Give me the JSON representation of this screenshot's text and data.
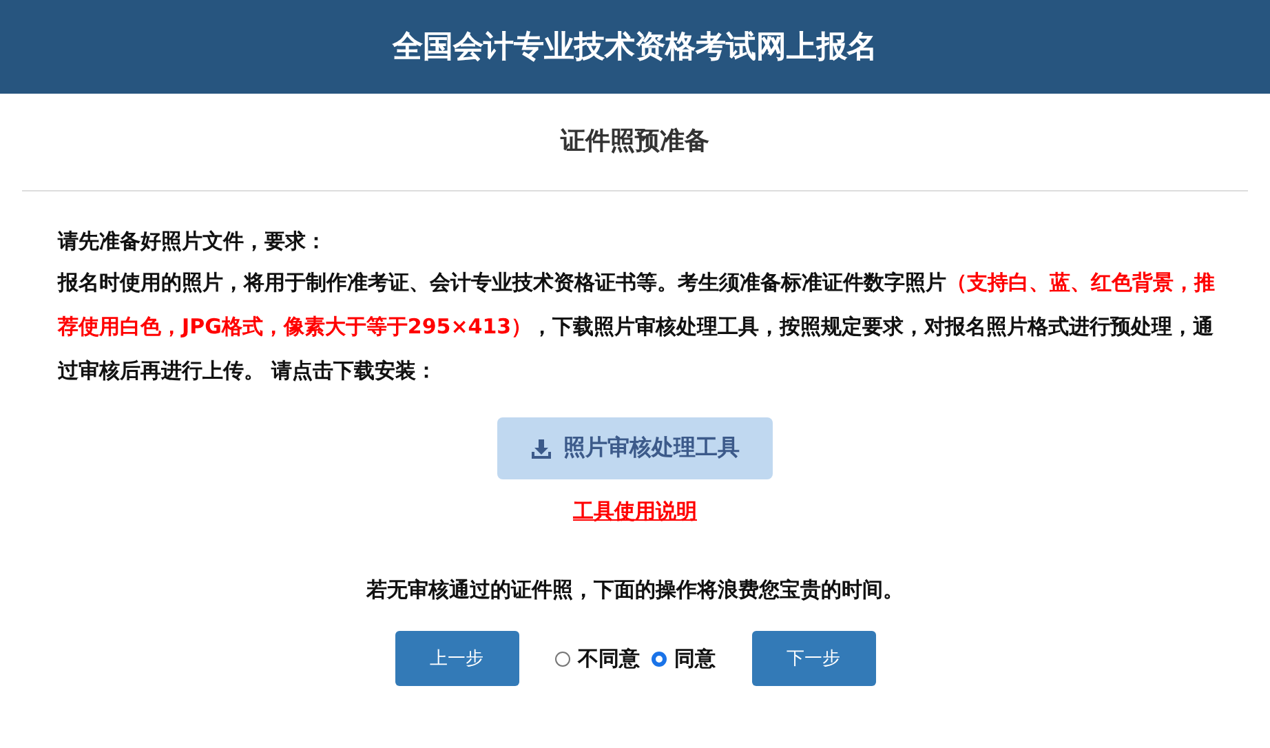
{
  "header": {
    "title": "全国会计专业技术资格考试网上报名"
  },
  "page_title": "证件照预准备",
  "intro": {
    "heading": "请先准备好照片文件，要求：",
    "segments": [
      {
        "kind": "normal",
        "text": "报名时使用的照片，将用于制作准考证、会计专业技术资格证书等。考生须准备标准证件数字照片"
      },
      {
        "kind": "highlight",
        "text": "（支持白、蓝、红色背景，推荐使用白色，JPG格式，像素大于等于295×413）"
      },
      {
        "kind": "normal",
        "text": "，下载照片审核处理工具，按照规定要求，对报名照片格式进行预处理，通过审核后再进行上传。 请点击下载安装："
      }
    ]
  },
  "download_button": "照片审核处理工具",
  "help_link": "工具使用说明",
  "warning": "若无审核通过的证件照，下面的操作将浪费您宝贵的时间。",
  "prev_button": "上一步",
  "consent": [
    {
      "label": "不同意",
      "selected": false
    },
    {
      "label": "同意",
      "selected": true
    }
  ],
  "next_button": "下一步"
}
